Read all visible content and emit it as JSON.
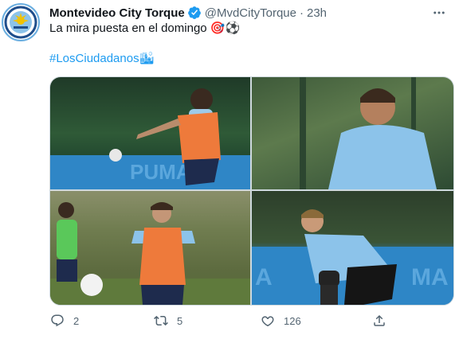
{
  "tweet": {
    "author_name": "Montevideo City Torque",
    "handle": "@MvdCityTorque",
    "separator": "·",
    "time": "23h",
    "text": "La mira puesta en el domingo 🎯⚽",
    "hashtag": "#LosCiudadanos🏙"
  },
  "actions": {
    "reply_count": "2",
    "retweet_count": "5",
    "like_count": "126"
  },
  "icons": {
    "verified": "verified-badge-icon",
    "more": "more-horizontal-icon",
    "reply": "reply-icon",
    "retweet": "retweet-icon",
    "like": "heart-icon",
    "share": "share-icon"
  },
  "colors": {
    "link": "#1d9bf0",
    "secondary_text": "#536471",
    "primary_text": "#0f1419",
    "verified": "#1d9bf0",
    "club_sky_blue": "#6aaee0"
  }
}
